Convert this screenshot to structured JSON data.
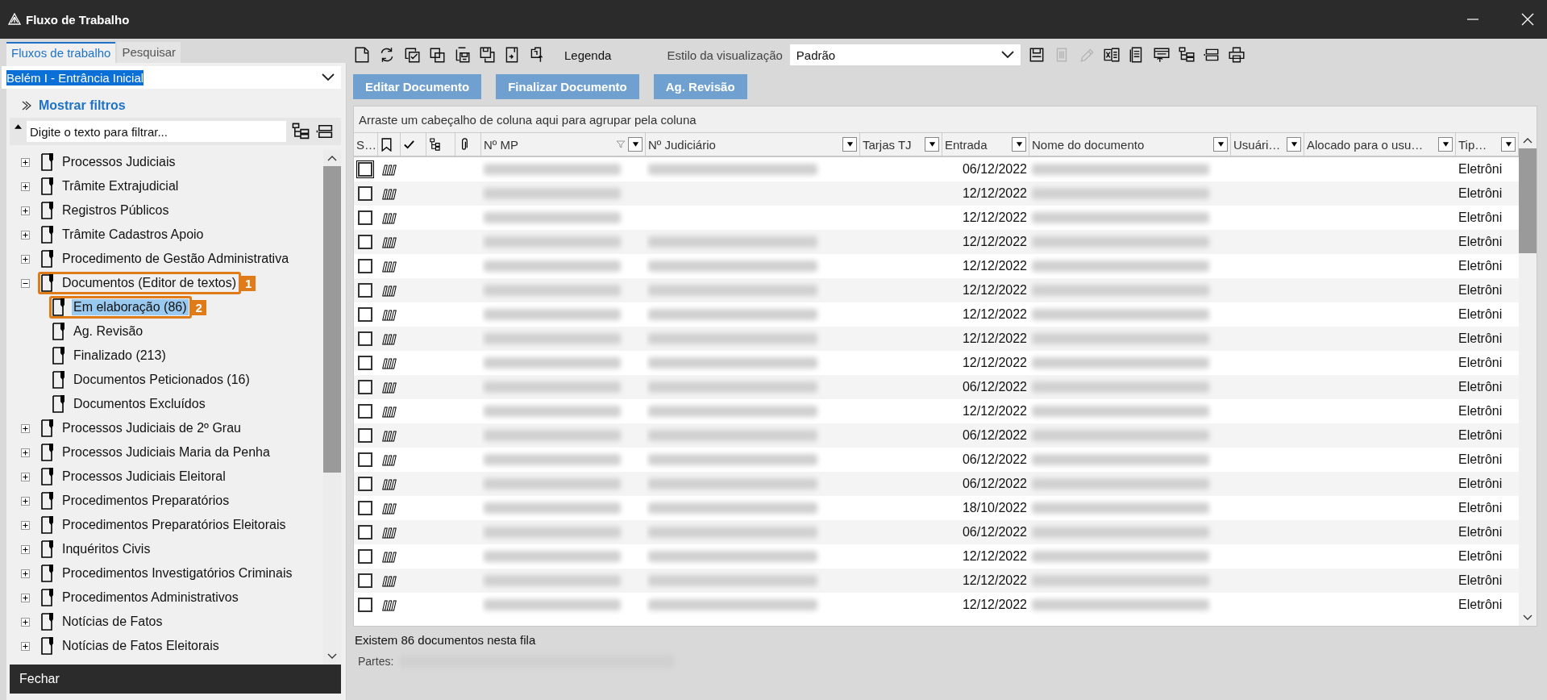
{
  "window": {
    "title": "Fluxo de Trabalho"
  },
  "left_panel": {
    "tabs": [
      {
        "label": "Fluxos de trabalho",
        "selected": true
      },
      {
        "label": "Pesquisar",
        "selected": false
      }
    ],
    "location_select": {
      "value": "Belém I - Entrância Inicial"
    },
    "filters_toggle": "Mostrar filtros",
    "filter_field": {
      "placeholder": "Digite o texto para filtrar..."
    },
    "tree": [
      {
        "label": "Processos Judiciais",
        "expanded": false,
        "selected": false
      },
      {
        "label": "Trâmite Extrajudicial",
        "expanded": false,
        "selected": false
      },
      {
        "label": "Registros Públicos",
        "expanded": false,
        "selected": false
      },
      {
        "label": "Trâmite Cadastros Apoio",
        "expanded": false,
        "selected": false
      },
      {
        "label": "Procedimento de Gestão Administrativa",
        "expanded": false,
        "selected": false
      },
      {
        "label": "Documentos (Editor de textos)",
        "expanded": true,
        "selected": false,
        "callout": "1",
        "children": [
          {
            "label": "Em elaboração (86)",
            "selected": true,
            "callout": "2"
          },
          {
            "label": "Ag. Revisão",
            "selected": false
          },
          {
            "label": "Finalizado (213)",
            "selected": false
          },
          {
            "label": "Documentos Peticionados (16)",
            "selected": false
          },
          {
            "label": "Documentos Excluídos",
            "selected": false
          }
        ]
      },
      {
        "label": "Processos Judiciais de 2º Grau",
        "expanded": false,
        "selected": false
      },
      {
        "label": "Processos Judiciais Maria da Penha",
        "expanded": false,
        "selected": false
      },
      {
        "label": "Processos Judiciais Eleitoral",
        "expanded": false,
        "selected": false
      },
      {
        "label": "Procedimentos Preparatórios",
        "expanded": false,
        "selected": false
      },
      {
        "label": "Procedimentos Preparatórios Eleitorais",
        "expanded": false,
        "selected": false
      },
      {
        "label": "Inquéritos Civis",
        "expanded": false,
        "selected": false
      },
      {
        "label": "Procedimentos Investigatórios Criminais",
        "expanded": false,
        "selected": false
      },
      {
        "label": "Procedimentos Administrativos",
        "expanded": false,
        "selected": false
      },
      {
        "label": "Notícias de Fatos",
        "expanded": false,
        "selected": false
      },
      {
        "label": "Notícias de Fatos Eleitorais",
        "expanded": false,
        "selected": false
      }
    ],
    "close_button": "Fechar"
  },
  "toolbar": {
    "left_tools": [
      {
        "kind": "new",
        "disabled": false
      },
      {
        "kind": "refresh",
        "disabled": false
      },
      {
        "kind": "checklist",
        "disabled": false
      },
      {
        "kind": "copy",
        "disabled": false
      },
      {
        "kind": "save-copy",
        "disabled": false
      },
      {
        "kind": "save-window",
        "disabled": false
      },
      {
        "kind": "import",
        "disabled": false
      },
      {
        "kind": "legend",
        "disabled": false
      }
    ],
    "legend_label": "Legenda",
    "view_style": {
      "label": "Estilo da visualização",
      "value": "Padrão"
    },
    "right_tools": [
      {
        "kind": "save",
        "disabled": false
      },
      {
        "kind": "trash",
        "disabled": true
      },
      {
        "kind": "pencil",
        "disabled": true
      },
      {
        "kind": "excel",
        "disabled": false
      },
      {
        "kind": "document",
        "disabled": false
      },
      {
        "kind": "export",
        "disabled": false
      },
      {
        "kind": "tree",
        "disabled": false
      },
      {
        "kind": "collapse",
        "disabled": false
      },
      {
        "kind": "print",
        "disabled": false
      }
    ]
  },
  "actions": [
    "Editar Documento",
    "Finalizar Documento",
    "Ag. Revisão"
  ],
  "grid": {
    "group_hint": "Arraste um cabeçalho de coluna aqui para agrupar pela coluna",
    "columns": [
      {
        "kind": "text",
        "label": "S…"
      },
      {
        "kind": "bookmark"
      },
      {
        "kind": "check"
      },
      {
        "kind": "tree"
      },
      {
        "kind": "clip"
      },
      {
        "kind": "text",
        "label": "Nº MP",
        "filter": true,
        "filtered": true
      },
      {
        "kind": "text",
        "label": "Nº Judiciário",
        "filter": true,
        "filtered": false
      },
      {
        "kind": "text",
        "label": "Tarjas TJ",
        "filter": true,
        "filtered": false
      },
      {
        "kind": "text",
        "label": "Entrada",
        "filter": true,
        "filtered": false
      },
      {
        "kind": "text",
        "label": "Nome do documento",
        "filter": true,
        "filtered": false
      },
      {
        "kind": "text",
        "label": "Usuári…",
        "filter": true,
        "filtered": false
      },
      {
        "kind": "text",
        "label": "Alocado para o usu…",
        "filter": true,
        "filtered": false
      },
      {
        "kind": "text",
        "label": "Tip…",
        "filter": true,
        "filtered": false
      }
    ],
    "rows": [
      {
        "checked": false,
        "focused": true,
        "judiciario_blurred": true,
        "entrada": "06/12/2022",
        "tipo": "Eletrôni"
      },
      {
        "checked": false,
        "focused": false,
        "judiciario_blurred": false,
        "entrada": "12/12/2022",
        "tipo": "Eletrôni"
      },
      {
        "checked": false,
        "focused": false,
        "judiciario_blurred": false,
        "entrada": "12/12/2022",
        "tipo": "Eletrôni"
      },
      {
        "checked": false,
        "focused": false,
        "judiciario_blurred": true,
        "entrada": "12/12/2022",
        "tipo": "Eletrôni"
      },
      {
        "checked": false,
        "focused": false,
        "judiciario_blurred": true,
        "entrada": "12/12/2022",
        "tipo": "Eletrôni"
      },
      {
        "checked": false,
        "focused": false,
        "judiciario_blurred": true,
        "entrada": "12/12/2022",
        "tipo": "Eletrôni"
      },
      {
        "checked": false,
        "focused": false,
        "judiciario_blurred": true,
        "entrada": "12/12/2022",
        "tipo": "Eletrôni"
      },
      {
        "checked": false,
        "focused": false,
        "judiciario_blurred": true,
        "entrada": "12/12/2022",
        "tipo": "Eletrôni"
      },
      {
        "checked": false,
        "focused": false,
        "judiciario_blurred": true,
        "entrada": "12/12/2022",
        "tipo": "Eletrôni"
      },
      {
        "checked": false,
        "focused": false,
        "judiciario_blurred": true,
        "entrada": "06/12/2022",
        "tipo": "Eletrôni"
      },
      {
        "checked": false,
        "focused": false,
        "judiciario_blurred": true,
        "entrada": "12/12/2022",
        "tipo": "Eletrôni"
      },
      {
        "checked": false,
        "focused": false,
        "judiciario_blurred": true,
        "entrada": "06/12/2022",
        "tipo": "Eletrôni"
      },
      {
        "checked": false,
        "focused": false,
        "judiciario_blurred": true,
        "entrada": "06/12/2022",
        "tipo": "Eletrôni"
      },
      {
        "checked": false,
        "focused": false,
        "judiciario_blurred": true,
        "entrada": "06/12/2022",
        "tipo": "Eletrôni"
      },
      {
        "checked": false,
        "focused": false,
        "judiciario_blurred": true,
        "entrada": "18/10/2022",
        "tipo": "Eletrôni"
      },
      {
        "checked": false,
        "focused": false,
        "judiciario_blurred": true,
        "entrada": "06/12/2022",
        "tipo": "Eletrôni"
      },
      {
        "checked": false,
        "focused": false,
        "judiciario_blurred": true,
        "entrada": "12/12/2022",
        "tipo": "Eletrôni"
      },
      {
        "checked": false,
        "focused": false,
        "judiciario_blurred": true,
        "entrada": "12/12/2022",
        "tipo": "Eletrôni"
      },
      {
        "checked": false,
        "focused": false,
        "judiciario_blurred": true,
        "entrada": "12/12/2022",
        "tipo": "Eletrôni"
      }
    ]
  },
  "status": {
    "count_text": "Existem 86 documentos nesta fila",
    "parts_label": "Partes:"
  }
}
